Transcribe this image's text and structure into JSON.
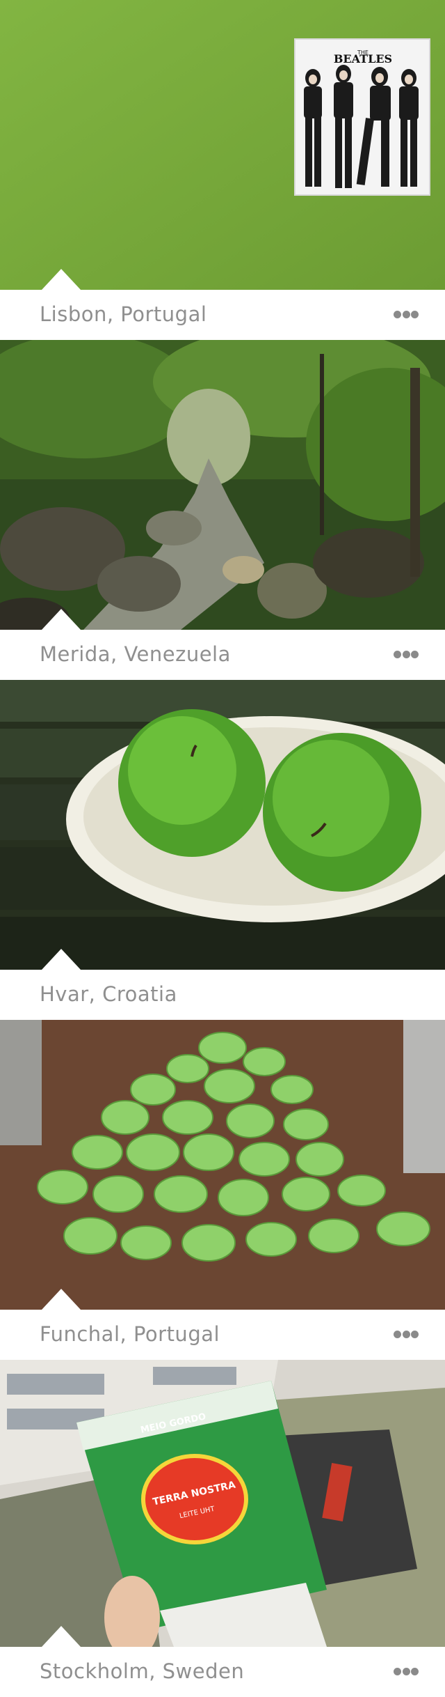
{
  "posts": [
    {
      "location": "Lisbon, Portugal",
      "image": "beatles-poster-on-green-wall",
      "show_more": true
    },
    {
      "location": "Merida, Venezuela",
      "image": "jungle-stream",
      "show_more": true
    },
    {
      "location": "Hvar, Croatia",
      "image": "green-apples-in-bowl",
      "show_more": false
    },
    {
      "location": "Funchal, Portugal",
      "image": "basil-plant",
      "show_more": true
    },
    {
      "location": "Stockholm, Sweden",
      "image": "terra-nostra-milk-carton",
      "show_more": true
    }
  ],
  "poster_text": {
    "small": "THE",
    "big": "BEATLES"
  },
  "carton_text": {
    "top": "MEIO GORDO",
    "brand": "TERRA NOSTRA",
    "sub": "LEITE UHT"
  },
  "colors": {
    "wall_green": "#79ad3b",
    "caption_text": "#8f8f8f",
    "dots": "#8a8a8a"
  }
}
